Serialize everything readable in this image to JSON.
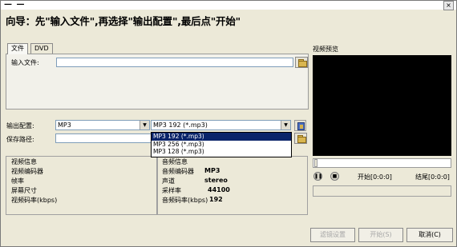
{
  "window": {
    "title": "— —",
    "close_label": "×"
  },
  "wizard_text": "向导：先\"输入文件\",再选择\"输出配置\",最后点\"开始\"",
  "tabs": [
    {
      "label": "文件",
      "active": true
    },
    {
      "label": "DVD",
      "active": false
    }
  ],
  "input_file": {
    "label": "输入文件:",
    "value": ""
  },
  "output_config": {
    "label": "输出配置:",
    "format_value": "MP3",
    "profile_value": "MP3 192 (*.mp3)",
    "profile_options": [
      "MP3 192 (*.mp3)",
      "MP3 256 (*.mp3)",
      "MP3 128 (*.mp3)"
    ],
    "selected_index": 0
  },
  "save_path": {
    "label": "保存路径:",
    "value": ""
  },
  "video_info": {
    "title": "视频信息",
    "rows": [
      "视频编码器",
      "帧率",
      "屏幕尺寸",
      "视频码率(kbps)"
    ]
  },
  "audio_info": {
    "title": "音频信息",
    "rows": [
      {
        "label": "音频编码器",
        "value": "MP3"
      },
      {
        "label": "声道",
        "value": "stereo"
      },
      {
        "label": "采样率",
        "value": "44100"
      },
      {
        "label": "音频码率(kbps)",
        "value": "192"
      }
    ]
  },
  "preview": {
    "label": "视频预览",
    "start_label": "开始[0:0:0]",
    "end_label": "结尾[0:0:0]"
  },
  "buttons": {
    "filter": "滤镜设置",
    "start": "开始(S)",
    "cancel": "取消(C)"
  },
  "colors": {
    "dialog_bg": "#ece9d8",
    "selection": "#0a246a",
    "preview_bg": "#000000"
  }
}
